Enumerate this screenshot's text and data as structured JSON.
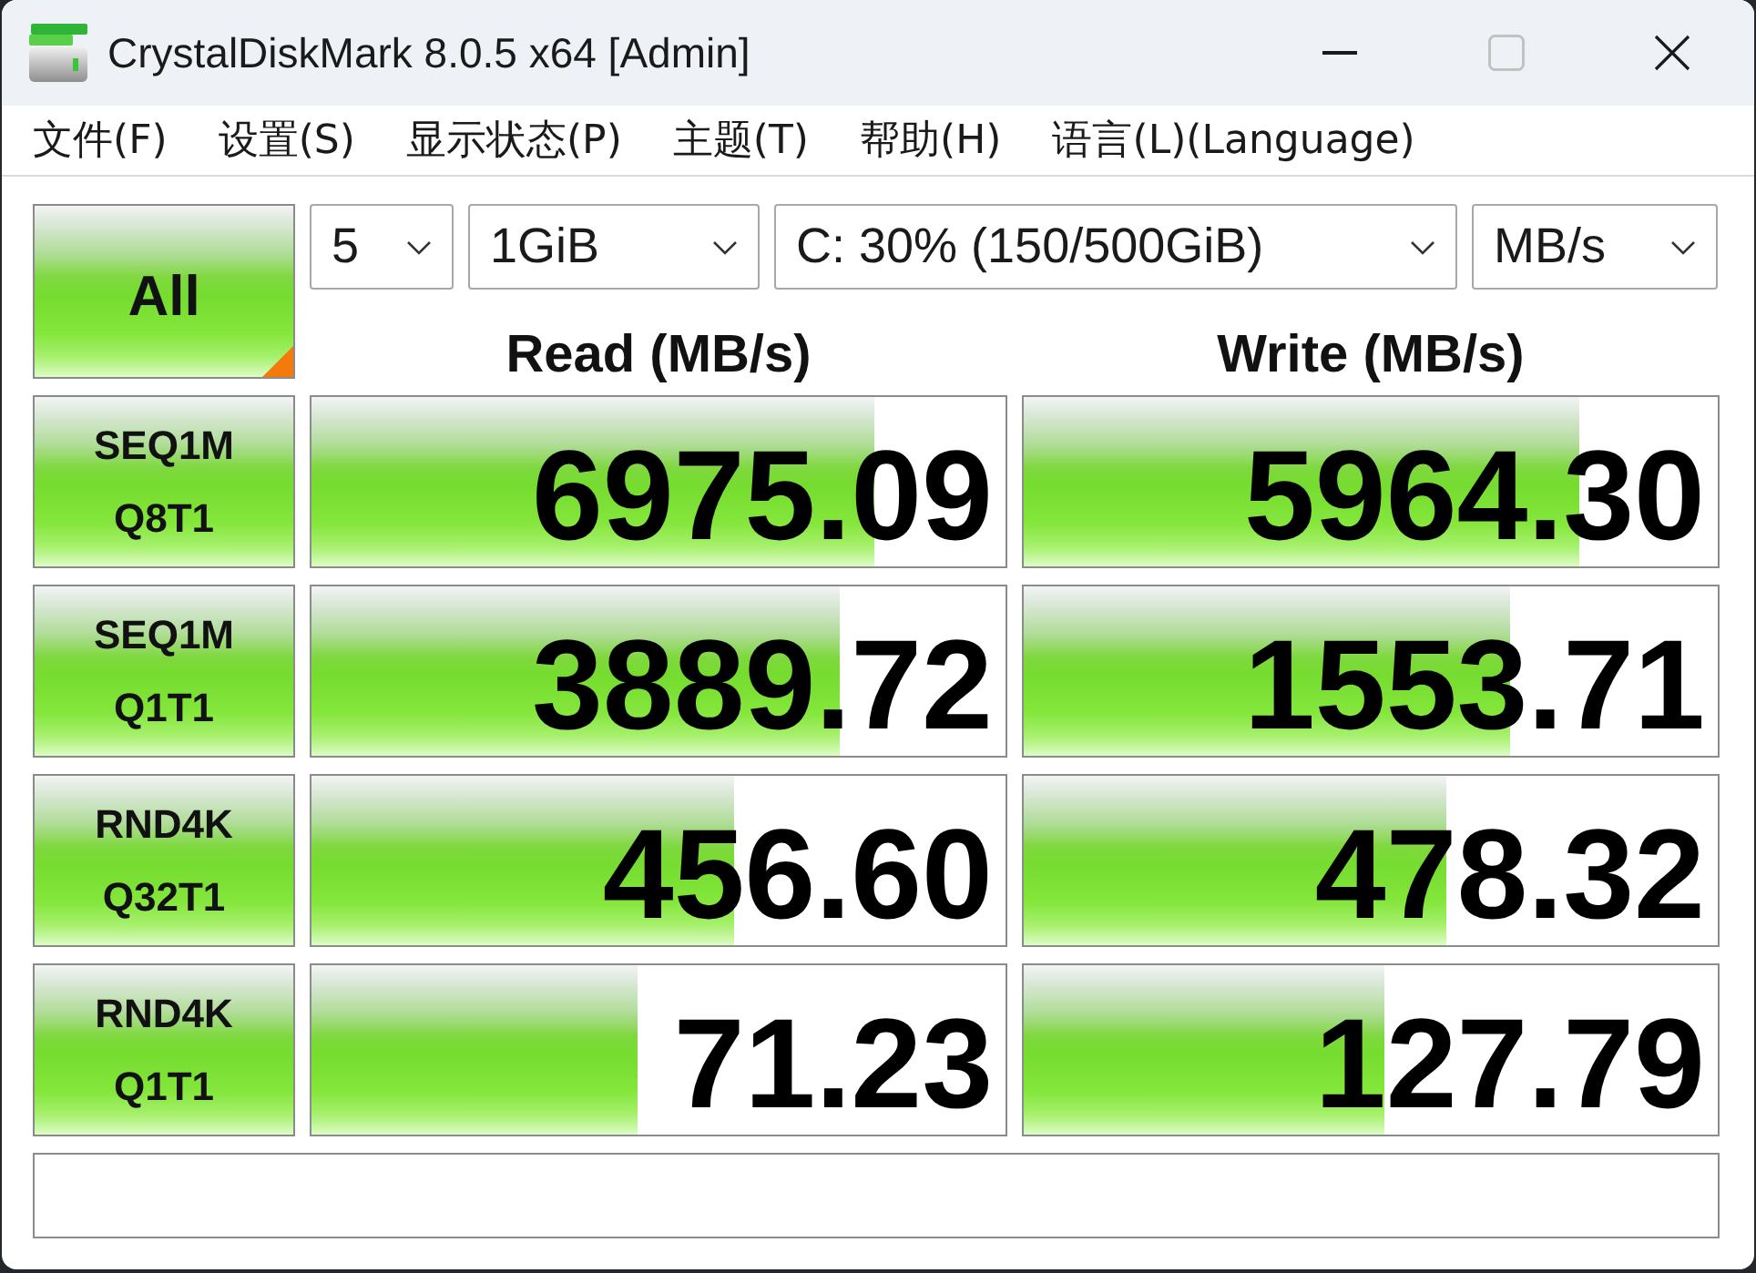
{
  "window": {
    "title": "CrystalDiskMark 8.0.5 x64 [Admin]",
    "maximize_disabled": true
  },
  "menu": [
    {
      "label": "文件(F)"
    },
    {
      "label": "设置(S)"
    },
    {
      "label": "显示状态(P)"
    },
    {
      "label": "主题(T)"
    },
    {
      "label": "帮助(H)"
    },
    {
      "label": "语言(L)(Language)"
    }
  ],
  "run_all": {
    "label": "All"
  },
  "selectors": [
    {
      "value": "5"
    },
    {
      "value": "1GiB"
    },
    {
      "value": "C: 30% (150/500GiB)"
    },
    {
      "value": "MB/s"
    }
  ],
  "headers": [
    "Read (MB/s)",
    "Write (MB/s)"
  ],
  "tests": [
    {
      "label": "SEQ1M",
      "detail": "Q8T1",
      "read": {
        "value": "6975.09",
        "level": 0.81
      },
      "write": {
        "value": "5964.30",
        "level": 0.8
      }
    },
    {
      "label": "SEQ1M",
      "detail": "Q1T1",
      "read": {
        "value": "3889.72",
        "level": 0.76
      },
      "write": {
        "value": "1553.71",
        "level": 0.7
      }
    },
    {
      "label": "RND4K",
      "detail": "Q32T1",
      "read": {
        "value": "456.60",
        "level": 0.61
      },
      "write": {
        "value": "478.32",
        "level": 0.61
      }
    },
    {
      "label": "RND4K",
      "detail": "Q1T1",
      "read": {
        "value": "71.23",
        "level": 0.47
      },
      "write": {
        "value": "127.79",
        "level": 0.52
      }
    }
  ]
}
